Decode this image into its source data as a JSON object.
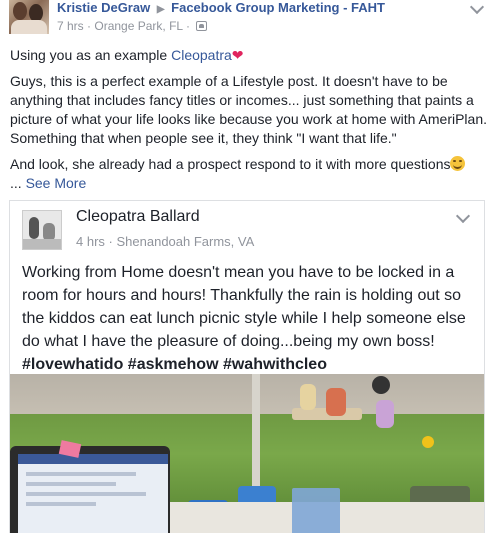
{
  "post": {
    "author": "Kristie DeGraw",
    "arrow": "▶",
    "group": "Facebook Group Marketing - FAHT",
    "time": "7 hrs",
    "location": "Orange Park, FL",
    "separator": "·",
    "paragraph1_prefix": "Using you as an example ",
    "paragraph1_mention": "Cleopatra",
    "paragraph1_emoji": "❤",
    "paragraph2": "Guys, this is a perfect example of a Lifestyle post. It doesn't have to be anything that includes fancy titles or incomes... just something that paints a picture of what your life looks like because you work at home with AmeriPlan. Something that when people see it, they think \"I want that life.\"",
    "paragraph3": "And look, she already had a prospect respond to it with more questions",
    "see_more_prefix": "... ",
    "see_more": "See More"
  },
  "shared_post": {
    "author": "Cleopatra Ballard",
    "time": "4 hrs",
    "separator": "·",
    "location": "Shenandoah Farms, VA",
    "text": "Working from Home doesn't mean you have to be locked in a room for hours and hours! Thankfully the rain is holding out so the kiddos can eat lunch picnic style while I help someone else do what I have the pleasure of doing...being my own boss! ",
    "hashtags": "#lovewhatido #askmehow #wahwithcleo"
  },
  "icons": {
    "author_avatar": "avatar-photo",
    "group_icon": "group-icon",
    "post_menu": "chevron-down-icon",
    "globe": "globe-icon",
    "heart": "heart-emoji",
    "smile": "smile-emoji"
  },
  "colors": {
    "link": "#365899",
    "text": "#1d2129",
    "meta": "#90949c",
    "heart": "#e0245e"
  }
}
